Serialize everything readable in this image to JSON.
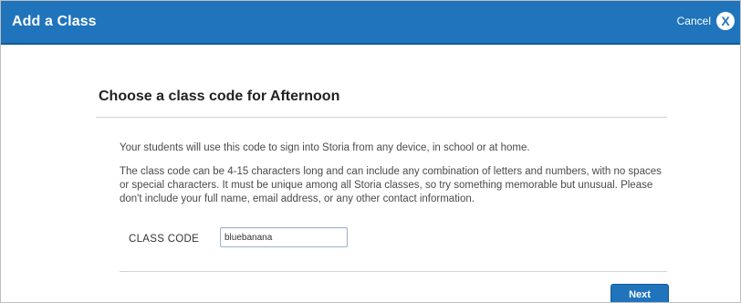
{
  "header": {
    "title": "Add a Class",
    "cancel_label": "Cancel",
    "close_glyph": "X"
  },
  "main": {
    "heading": "Choose a class code for Afternoon",
    "paragraph1": "Your students will use this code to sign into Storia from any device, in school or at home.",
    "paragraph2": "The class code can be 4-15 characters long and can include any combination of letters and numbers, with no spaces or special characters. It must be unique among all Storia classes, so try something memorable but unusual. Please don't include your full name, email address, or any other contact information.",
    "class_code_label": "CLASS CODE",
    "class_code_value": "bluebanana",
    "next_label": "Next"
  },
  "colors": {
    "header_bg": "#1f74bc",
    "button_bg": "#1f74bc"
  }
}
